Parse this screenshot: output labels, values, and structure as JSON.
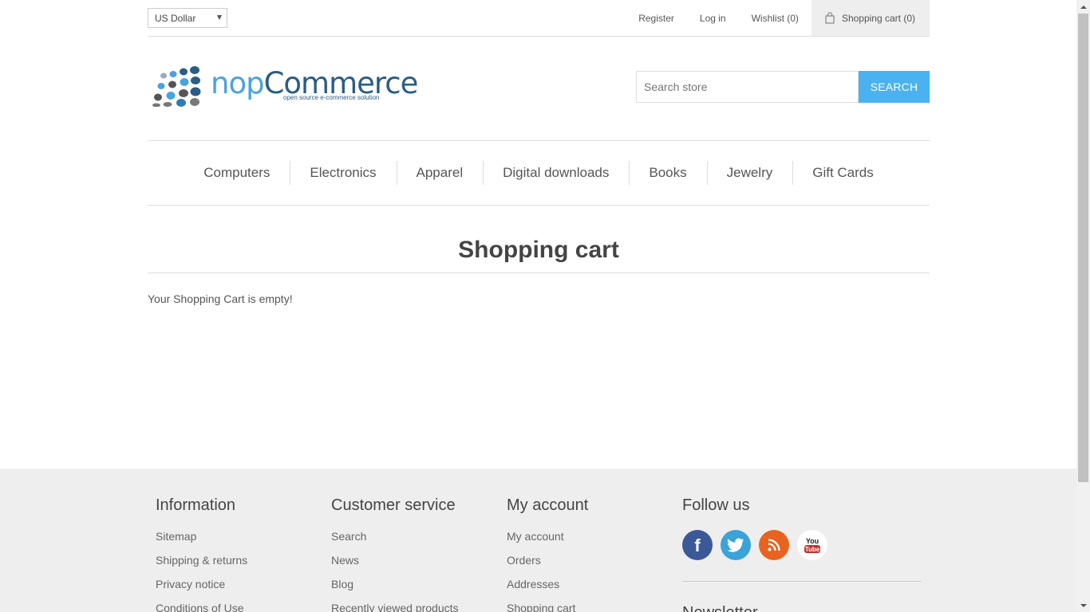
{
  "header": {
    "currency": "US Dollar",
    "links": {
      "register": "Register",
      "login": "Log in",
      "wishlist": "Wishlist (0)",
      "cart": "Shopping cart (0)"
    }
  },
  "logo": {
    "word1": "nop",
    "word2": "Commerce",
    "tagline": "open source e-commerce solution"
  },
  "search": {
    "placeholder": "Search store",
    "button": "SEARCH"
  },
  "menu": [
    "Computers",
    "Electronics",
    "Apparel",
    "Digital downloads",
    "Books",
    "Jewelry",
    "Gift Cards"
  ],
  "main": {
    "title": "Shopping cart",
    "message": "Your Shopping Cart is empty!"
  },
  "footer": {
    "information": {
      "title": "Information",
      "items": [
        "Sitemap",
        "Shipping & returns",
        "Privacy notice",
        "Conditions of Use"
      ]
    },
    "customer_service": {
      "title": "Customer service",
      "items": [
        "Search",
        "News",
        "Blog",
        "Recently viewed products"
      ]
    },
    "my_account": {
      "title": "My account",
      "items": [
        "My account",
        "Orders",
        "Addresses",
        "Shopping cart"
      ]
    },
    "follow": {
      "title": "Follow us",
      "icons": [
        "facebook-icon",
        "twitter-icon",
        "rss-icon",
        "youtube-icon"
      ],
      "colors": {
        "facebook": "#3b5998",
        "twitter": "#3aa3d8",
        "rss": "#e8631f",
        "youtube": "#ffffff"
      }
    },
    "newsletter": "Newsletter"
  },
  "colors": {
    "accent": "#4ab2f1",
    "footer_bg": "#eeeeee"
  }
}
